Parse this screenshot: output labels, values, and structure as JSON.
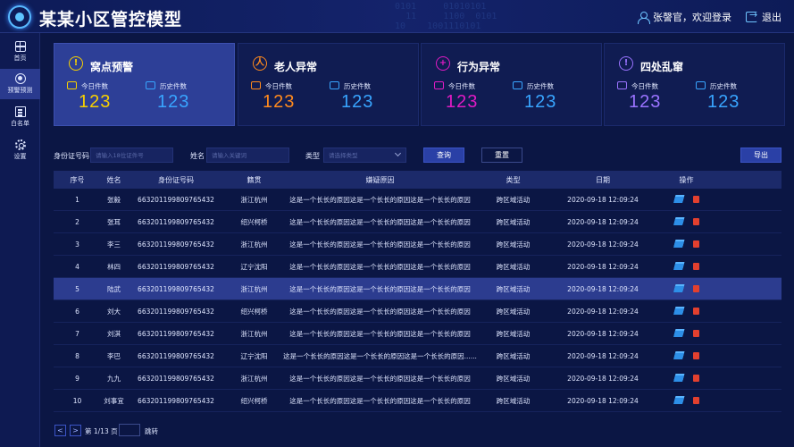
{
  "app": {
    "title": "某某小区管控模型",
    "user_greeting": "张謦官，欢迎登录",
    "logout_label": "退出"
  },
  "decor": {
    "code_lines": "  0101     01010101\n    11     1100  0101\n  10    1001110101"
  },
  "sidebar": {
    "items": [
      {
        "label": "首页",
        "icon": "home-icon"
      },
      {
        "label": "预警预测",
        "icon": "alert-icon"
      },
      {
        "label": "白名单",
        "icon": "list-icon"
      },
      {
        "label": "设置",
        "icon": "gear-icon"
      }
    ]
  },
  "cards": [
    {
      "title": "窝点预警",
      "today_label": "今日件数",
      "today_value": "123",
      "history_label": "历史件数",
      "history_value": "123",
      "accent": "#f7d000",
      "accent2": "#38a5ff",
      "active": true
    },
    {
      "title": "老人异常",
      "today_label": "今日件数",
      "today_value": "123",
      "history_label": "历史件数",
      "history_value": "123",
      "accent": "#ff8a1d",
      "accent2": "#38a5ff",
      "active": false
    },
    {
      "title": "行为异常",
      "today_label": "今日件数",
      "today_value": "123",
      "history_label": "历史件数",
      "history_value": "123",
      "accent": "#e01bc4",
      "accent2": "#38a5ff",
      "active": false
    },
    {
      "title": "四处乱窜",
      "today_label": "今日件数",
      "today_value": "123",
      "history_label": "历史件数",
      "history_value": "123",
      "accent": "#9a73ff",
      "accent2": "#38a5ff",
      "active": false
    }
  ],
  "filters": {
    "id_label": "身份证号码",
    "id_placeholder": "请输入18位证件号",
    "name_label": "姓名",
    "name_placeholder": "请输入关键词",
    "type_label": "类型",
    "type_placeholder": "请选择类型",
    "query_label": "查询",
    "reset_label": "重置",
    "export_label": "导出"
  },
  "table": {
    "headers": [
      "序号",
      "姓名",
      "身份证号码",
      "籍贯",
      "嫌疑原因",
      "类型",
      "日期",
      "操作"
    ],
    "rows": [
      [
        "1",
        "张毅",
        "663201199809765432",
        "浙江杭州",
        "这是一个长长的原因这是一个长长的原因这是一个长长的原因",
        "跨区域活动",
        "2020-09-18  12:09:24"
      ],
      [
        "2",
        "张耳",
        "663201199809765432",
        "绍兴柯桥",
        "这是一个长长的原因这是一个长长的原因这是一个长长的原因",
        "跨区域活动",
        "2020-09-18  12:09:24"
      ],
      [
        "3",
        "李三",
        "663201199809765432",
        "浙江杭州",
        "这是一个长长的原因这是一个长长的原因这是一个长长的原因",
        "跨区域活动",
        "2020-09-18  12:09:24"
      ],
      [
        "4",
        "林四",
        "663201199809765432",
        "辽宁沈阳",
        "这是一个长长的原因这是一个长长的原因这是一个长长的原因",
        "跨区域活动",
        "2020-09-18  12:09:24"
      ],
      [
        "5",
        "陆武",
        "663201199809765432",
        "浙江杭州",
        "这是一个长长的原因这是一个长长的原因这是一个长长的原因",
        "跨区域活动",
        "2020-09-18  12:09:24"
      ],
      [
        "6",
        "刘大",
        "663201199809765432",
        "绍兴柯桥",
        "这是一个长长的原因这是一个长长的原因这是一个长长的原因",
        "跨区域活动",
        "2020-09-18  12:09:24"
      ],
      [
        "7",
        "刘淇",
        "663201199809765432",
        "浙江杭州",
        "这是一个长长的原因这是一个长长的原因这是一个长长的原因",
        "跨区域活动",
        "2020-09-18  12:09:24"
      ],
      [
        "8",
        "李巴",
        "663201199809765432",
        "辽宁沈阳",
        "这是一个长长的原因这是一个长长的原因这是一个长长的原因......",
        "跨区域活动",
        "2020-09-18  12:09:24"
      ],
      [
        "9",
        "九九",
        "663201199809765432",
        "浙江杭州",
        "这是一个长长的原因这是一个长长的原因这是一个长长的原因",
        "跨区域活动",
        "2020-09-18  12:09:24"
      ],
      [
        "10",
        "刘事宜",
        "663201199809765432",
        "绍兴柯桥",
        "这是一个长长的原因这是一个长长的原因这是一个长长的原因",
        "跨区域活动",
        "2020-09-18  12:09:24"
      ]
    ],
    "selected_row": 4
  },
  "pagination": {
    "prev": "<",
    "next": ">",
    "page_text": "第 1/13 页",
    "jump_label": "跳转"
  }
}
